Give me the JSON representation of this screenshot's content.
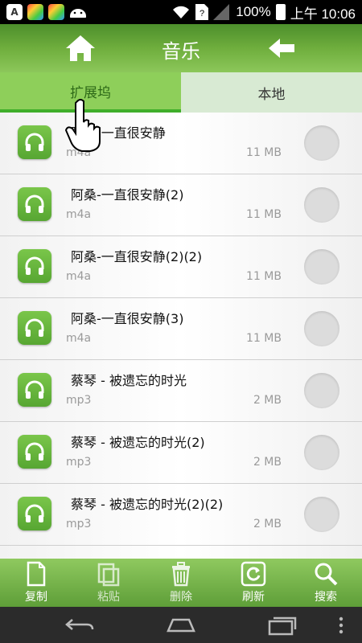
{
  "status_bar": {
    "app_icons": [
      "A"
    ],
    "battery": "100%",
    "time": "上午 10:06"
  },
  "header": {
    "title": "音乐"
  },
  "tabs": [
    {
      "label": "扩展坞",
      "active": true
    },
    {
      "label": "本地",
      "active": false
    }
  ],
  "files": [
    {
      "name": "阿桑-一直很安静",
      "type": "m4a",
      "size": "11 MB"
    },
    {
      "name": "阿桑-一直很安静(2)",
      "type": "m4a",
      "size": "11 MB"
    },
    {
      "name": "阿桑-一直很安静(2)(2)",
      "type": "m4a",
      "size": "11 MB"
    },
    {
      "name": "阿桑-一直很安静(3)",
      "type": "m4a",
      "size": "11 MB"
    },
    {
      "name": "蔡琴 - 被遗忘的时光",
      "type": "mp3",
      "size": "2 MB"
    },
    {
      "name": "蔡琴 - 被遗忘的时光(2)",
      "type": "mp3",
      "size": "2 MB"
    },
    {
      "name": "蔡琴 - 被遗忘的时光(2)(2)",
      "type": "mp3",
      "size": "2 MB"
    }
  ],
  "toolbar": {
    "copy": "复制",
    "paste": "粘贴",
    "delete": "删除",
    "refresh": "刷新",
    "search": "搜索"
  },
  "colors": {
    "accent": "#6fae3d",
    "tab_active": "#8ecf5a"
  },
  "icons": [
    "home-icon",
    "back-arrow-icon",
    "headphones-icon",
    "copy-icon",
    "paste-icon",
    "trash-icon",
    "refresh-icon",
    "search-icon",
    "hand-cursor-icon"
  ]
}
